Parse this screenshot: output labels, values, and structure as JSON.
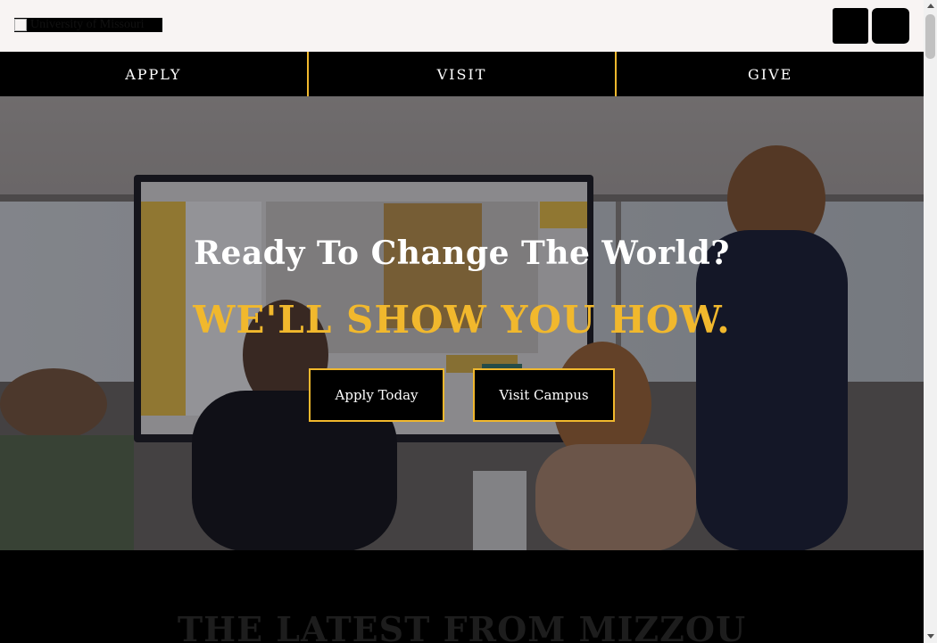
{
  "header": {
    "logo_alt": "University of Missouri",
    "search_icon": "search-icon",
    "menu_icon": "menu-icon"
  },
  "quicknav": {
    "items": [
      {
        "label": "APPLY"
      },
      {
        "label": "VISIT"
      },
      {
        "label": "GIVE"
      }
    ]
  },
  "hero": {
    "title": "Ready To Change The World?",
    "subtitle": "WE'LL SHOW YOU HOW.",
    "apply_button": "Apply Today",
    "visit_button": "Visit Campus"
  },
  "latest": {
    "title": "THE LATEST FROM MIZZOU"
  },
  "colors": {
    "gold": "#f1b82d",
    "black": "#000000",
    "header_bg": "#f8f4f3"
  }
}
